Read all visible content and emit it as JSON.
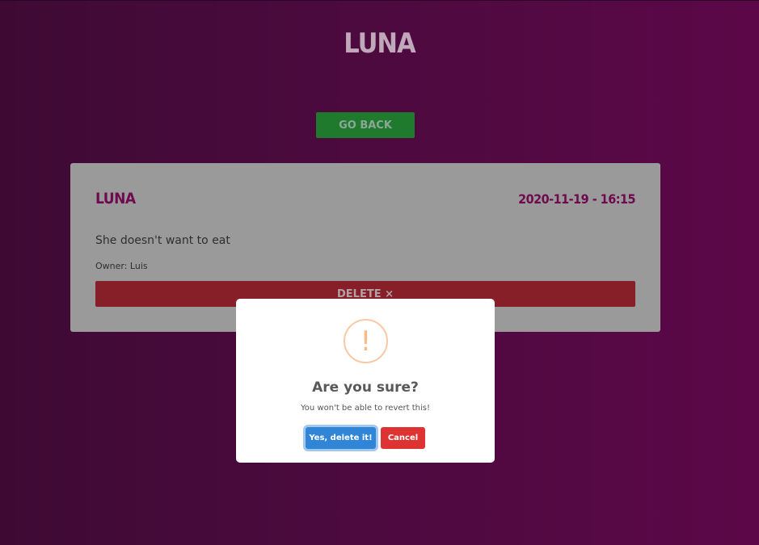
{
  "page": {
    "title": "LUNA",
    "go_back_label": "GO BACK"
  },
  "card": {
    "name": "LUNA",
    "date": "2020-11-19 - 16:15",
    "description": "She doesn't want to eat",
    "owner": "Owner: Luis",
    "delete_label": "DELETE ×"
  },
  "modal": {
    "icon": "!",
    "icon_name": "warning-icon",
    "title": "Are you sure?",
    "text": "You won't be able to revert this!",
    "confirm_label": "Yes, delete it!",
    "cancel_label": "Cancel"
  },
  "colors": {
    "background_start": "#3e0a34",
    "background_end": "#5c0848",
    "go_back": "#1f7a2d",
    "delete": "#861f28",
    "confirm": "#3085d6",
    "cancel": "#dd3333",
    "warning": "#f8bb86"
  }
}
